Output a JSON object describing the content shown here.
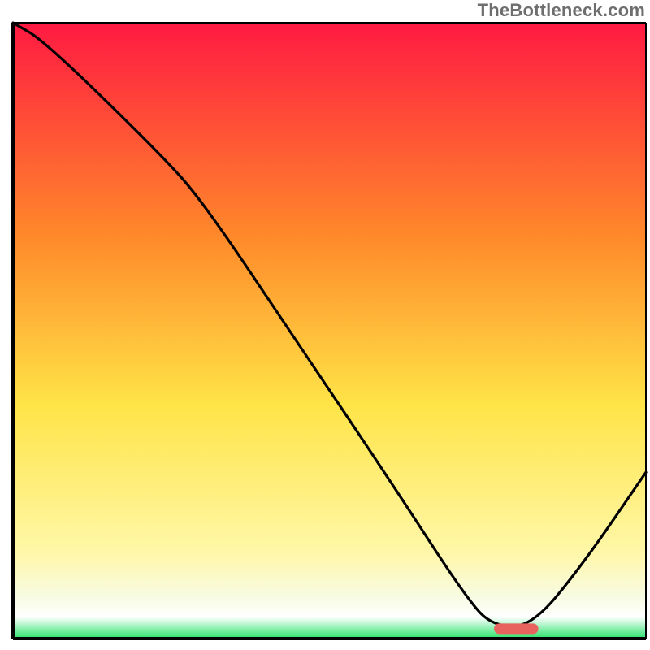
{
  "watermark": "TheBottleneck.com",
  "colors": {
    "frame": "#000000",
    "curve": "#000000",
    "marker_fill": "#e9635e",
    "white": "#ffffff",
    "gradient_top": "#ff1a42",
    "gradient_mid_upper": "#ff8a2a",
    "gradient_mid": "#ffe447",
    "gradient_lower_yellow": "#fff7a8",
    "gradient_pale": "#f7fbe0",
    "gradient_green": "#28e36b"
  },
  "chart_data": {
    "type": "line",
    "title": "",
    "xlabel": "",
    "ylabel": "",
    "xlim": [
      0,
      100
    ],
    "ylim": [
      0,
      100
    ],
    "grid": false,
    "legend": false,
    "series": [
      {
        "name": "bottleneck-curve",
        "x": [
          0,
          5,
          23,
          30,
          45,
          60,
          72,
          76,
          82,
          90,
          100
        ],
        "y": [
          100,
          97,
          79,
          71,
          48,
          25,
          6,
          2,
          2,
          12,
          27
        ]
      }
    ],
    "marker": {
      "name": "optimal-range",
      "x_start": 76,
      "x_end": 83,
      "y": 1.6
    },
    "background_gradient_stops": [
      {
        "offset": 0.0,
        "key": "gradient_top"
      },
      {
        "offset": 0.35,
        "key": "gradient_mid_upper"
      },
      {
        "offset": 0.62,
        "key": "gradient_mid"
      },
      {
        "offset": 0.86,
        "key": "gradient_lower_yellow"
      },
      {
        "offset": 0.93,
        "key": "gradient_pale"
      },
      {
        "offset": 0.965,
        "key": "white"
      },
      {
        "offset": 1.0,
        "key": "gradient_green"
      }
    ]
  }
}
